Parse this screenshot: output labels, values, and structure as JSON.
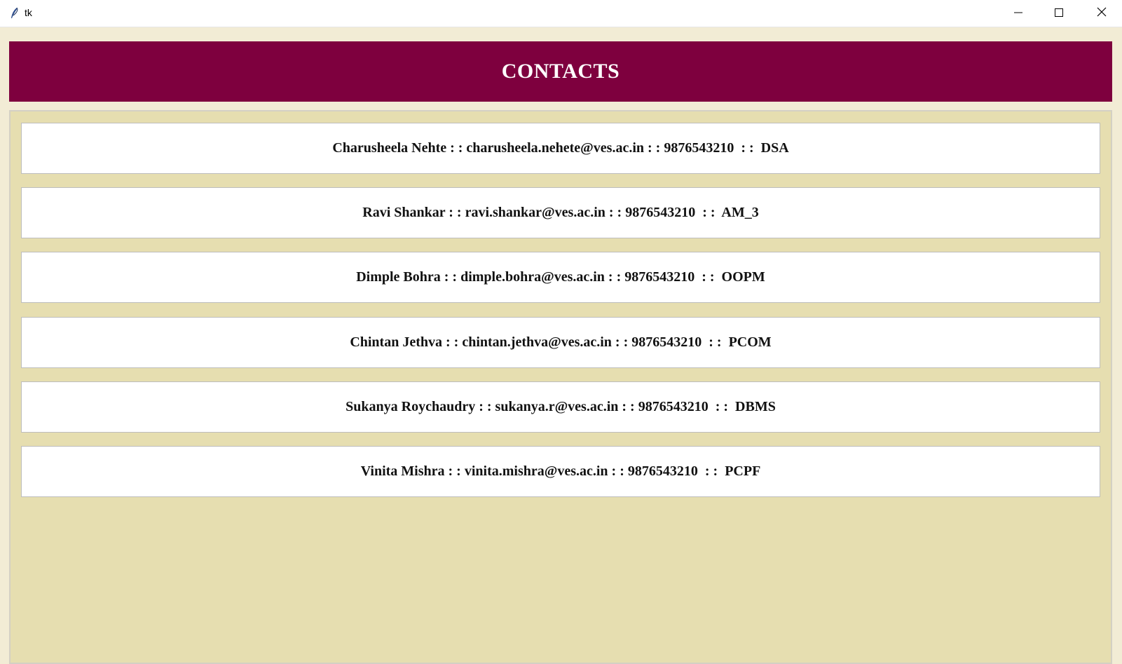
{
  "window": {
    "title": "tk",
    "icon": "feather-icon",
    "controls": {
      "minimize": "minimize-icon",
      "maximize": "maximize-icon",
      "close": "close-icon"
    }
  },
  "header": {
    "title": "CONTACTS",
    "background": "#7e003e"
  },
  "contacts": [
    {
      "text": "Charusheela Nehte : : charusheela.nehete@ves.ac.in : : 9876543210  : :  DSA"
    },
    {
      "text": "Ravi Shankar : : ravi.shankar@ves.ac.in : : 9876543210  : :  AM_3"
    },
    {
      "text": "Dimple Bohra : : dimple.bohra@ves.ac.in : : 9876543210  : :  OOPM"
    },
    {
      "text": "Chintan Jethva : : chintan.jethva@ves.ac.in : : 9876543210  : :  PCOM"
    },
    {
      "text": "Sukanya Roychaudry : : sukanya.r@ves.ac.in : : 9876543210  : :  DBMS"
    },
    {
      "text": "Vinita Mishra : : vinita.mishra@ves.ac.in : : 9876543210  : :  PCPF"
    }
  ],
  "colors": {
    "window_bg": "#f2ecd5",
    "list_bg": "#e6deb0",
    "card_bg": "#ffffff"
  }
}
